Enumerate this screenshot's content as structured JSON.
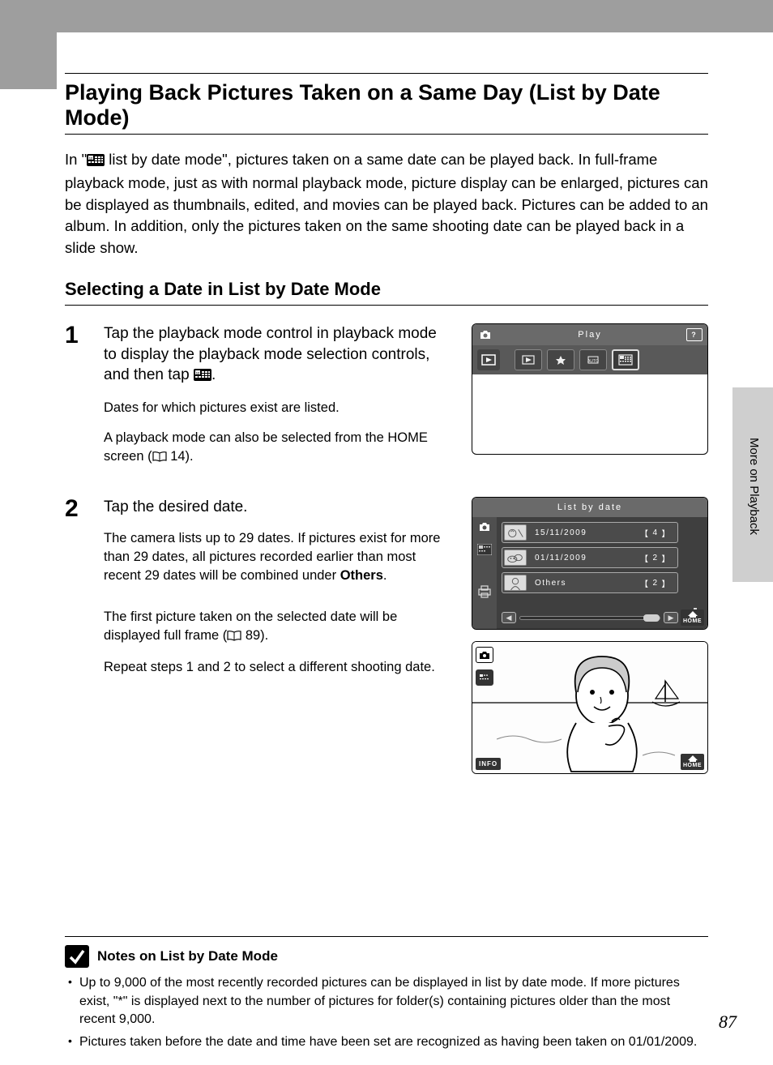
{
  "sidebar_label": "More on Playback",
  "page_title": "Playing Back Pictures Taken on a Same Day (List by Date Mode)",
  "intro_before_icon": "In \"",
  "intro_after_icon": " list by date mode\", pictures taken on a same date can be played back. In full-frame playback mode, just as with normal playback mode, picture display can be enlarged, pictures can be displayed as thumbnails, edited, and movies can be played back. Pictures can be added to an album. In addition, only the pictures taken on the same shooting date can be played back in a slide show.",
  "section_heading": "Selecting a Date in List by Date Mode",
  "step1": {
    "num": "1",
    "title_before": "Tap the playback mode control in playback mode to display the playback mode selection controls, and then tap ",
    "title_after": ".",
    "sub1": "Dates for which pictures exist are listed.",
    "sub2_before": "A playback mode can also be selected from the HOME screen (",
    "sub2_ref": " 14).",
    "screen_title": "Play"
  },
  "step2": {
    "num": "2",
    "title": "Tap the desired date.",
    "sub1_before": "The camera lists up to 29 dates. If pictures exist for more than 29 dates, all pictures recorded earlier than most recent 29 dates will be combined under ",
    "sub1_bold": "Others",
    "sub1_after": ".",
    "sub2_before": "The first picture taken on the selected date will be displayed full frame (",
    "sub2_ref": " 89).",
    "sub3": "Repeat steps 1 and 2 to select a different shooting date.",
    "screen_title": "List by date",
    "dates": [
      {
        "label": "15/11/2009",
        "count": "4"
      },
      {
        "label": "01/11/2009",
        "count": "2"
      },
      {
        "label": "Others",
        "count": "2"
      }
    ],
    "info_label": "INFO",
    "home_label": "HOME"
  },
  "notes": {
    "title": "Notes on List by Date Mode",
    "items": [
      "Up to 9,000 of the most recently recorded pictures can be displayed in list by date mode. If more pictures exist, \"*\" is displayed next to the number of pictures for folder(s) containing pictures older than the most recent 9,000.",
      "Pictures taken before the date and time have been set are recognized as having been taken on 01/01/2009."
    ]
  },
  "page_number": "87"
}
